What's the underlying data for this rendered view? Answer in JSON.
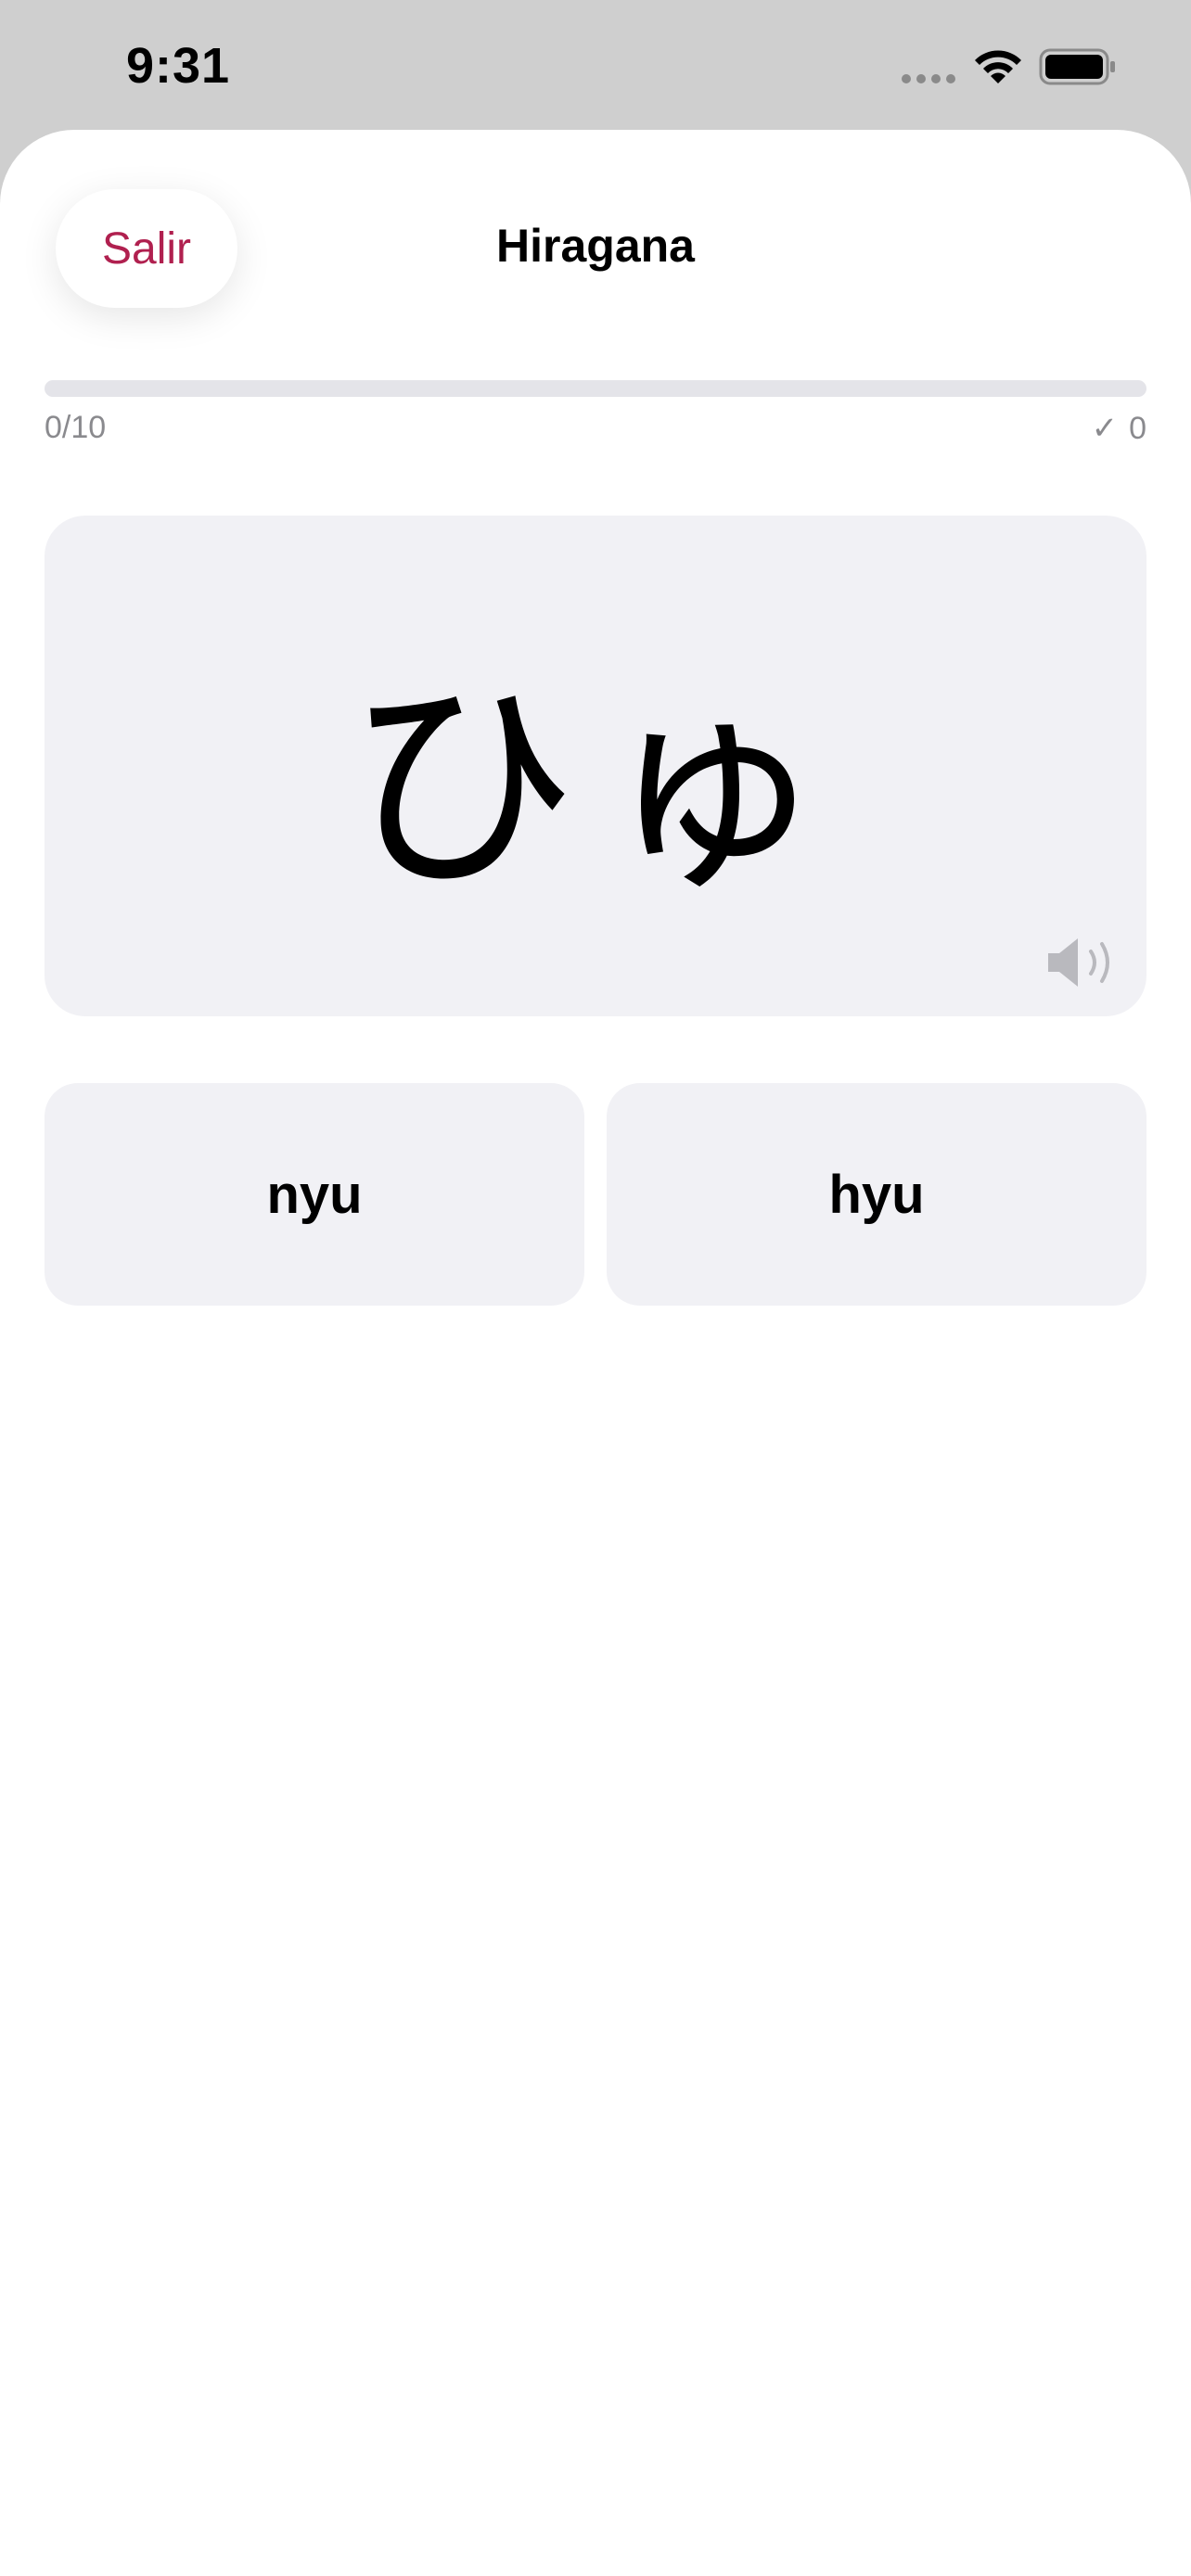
{
  "status_bar": {
    "time": "9:31"
  },
  "header": {
    "exit_label": "Salir",
    "title": "Hiragana"
  },
  "progress": {
    "label": "0/10",
    "fraction": 0,
    "correct_count": "0",
    "check_symbol": "✓"
  },
  "card": {
    "kana": "ひゅ",
    "audio_icon": "speaker-icon"
  },
  "options": [
    {
      "label": "nyu"
    },
    {
      "label": "hyu"
    }
  ],
  "colors": {
    "accent": "#b0204f",
    "card_bg": "#f1f1f5",
    "muted_text": "#8a8a8e"
  }
}
